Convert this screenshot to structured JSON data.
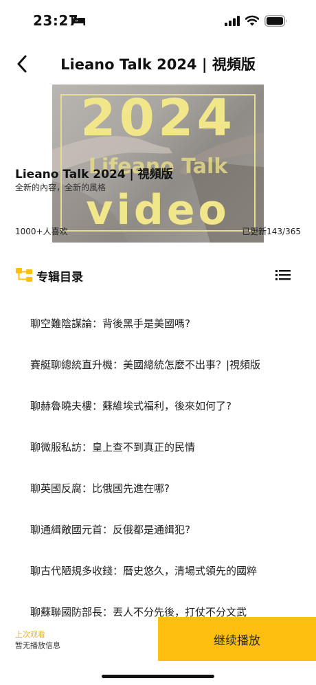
{
  "status_bar": {
    "time": "23:27",
    "icons": [
      "bed-icon",
      "cellular-signal-icon",
      "wifi-icon",
      "battery-icon"
    ]
  },
  "nav": {
    "back_icon": "chevron-left-icon",
    "title": "Lieano Talk 2024 | 視頻版"
  },
  "cover": {
    "year_text": "2024",
    "brand_text": "Lifeano Talk",
    "video_text": "video",
    "accent_color": "#f2e68a"
  },
  "album": {
    "title": "Lieano Talk 2024 | 視頻版",
    "subtitle": "全新的內容，全新的風格",
    "likes": "1000+人喜欢",
    "update_count": "已更新143/365"
  },
  "catalog": {
    "icon": "tree-structure-icon",
    "title": "专辑目录",
    "list_icon": "list-icon",
    "icon_color": "#ffbf11"
  },
  "episodes": [
    "聊空難陰謀論：背後黑手是美國嗎?",
    "賽艇聊總統直升機：美國總統怎麼不出事？|視頻版",
    "聊赫魯曉夫樓：蘇維埃式福利，後來如何了?",
    "聊微服私訪：皇上查不到真正的民情",
    "聊英國反腐：比俄國先進在哪?",
    "聊通緝敵國元首：反俄都是通緝犯?",
    "聊古代陋規多收錢：曆史悠久，清場式領先的國粹",
    "聊蘇聯國防部長：丟人不分先後，打仗不分文武"
  ],
  "bottom_bar": {
    "last_watched_label": "上次观看",
    "last_watched_info": "暂无播放信息",
    "continue_label": "继续播放",
    "button_color": "#ffbf11"
  }
}
